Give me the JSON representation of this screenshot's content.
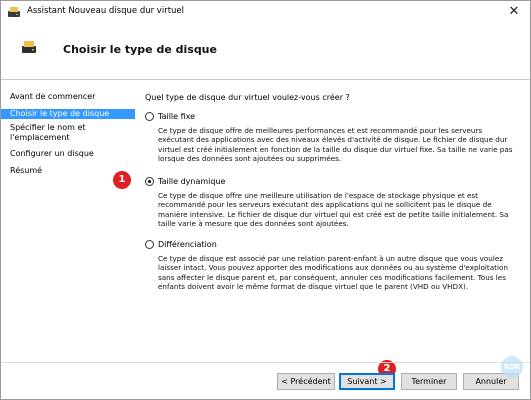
{
  "window": {
    "title": "Assistant Nouveau disque dur virtuel",
    "close_glyph": "✕"
  },
  "header": {
    "title": "Choisir le type de disque",
    "icon": "hard-disk-icon"
  },
  "nav": {
    "items": [
      {
        "label": "Avant de commencer",
        "active": false
      },
      {
        "label": "Choisir le type de disque",
        "active": true
      },
      {
        "label": "Spécifier le nom et l'emplacement",
        "active": false
      },
      {
        "label": "Configurer un disque",
        "active": false
      },
      {
        "label": "Résumé",
        "active": false
      }
    ]
  },
  "main": {
    "question": "Quel type de disque dur virtuel voulez-vous créer ?",
    "options": [
      {
        "label": "Taille fixe",
        "selected": false,
        "description": "Ce type de disque offre de meilleures performances et est recommandé pour les serveurs exécutant des applications avec des niveaux élevés d'activité de disque. Le fichier de disque dur virtuel est créé initialement en fonction de la taille du disque dur virtuel fixe. Sa taille ne varie pas lorsque des données sont ajoutées ou supprimées."
      },
      {
        "label": "Taille dynamique",
        "selected": true,
        "description": "Ce type de disque offre une meilleure utilisation de l'espace de stockage physique et est recommandé pour les serveurs exécutant des applications qui ne sollicitent pas le disque de manière intensive. Le fichier de disque dur virtuel qui est créé est de petite taille initialement. Sa taille varie à mesure que des données sont ajoutées."
      },
      {
        "label": "Différenciation",
        "selected": false,
        "description": "Ce type de disque est associé par une relation parent-enfant à un autre disque que vous voulez laisser intact. Vous pouvez apporter des modifications aux données ou au système d'exploitation sans affecter le disque parent et, par conséquent, annuler ces modifications facilement. Tous les enfants doivent avoir le même format de disque virtuel que le parent (VHD ou VHDX)."
      }
    ]
  },
  "annotations": {
    "step1": "1",
    "step2": "2"
  },
  "buttons": {
    "previous": "< Précédent",
    "next": "Suivant >",
    "finish": "Terminer",
    "cancel": "Annuler"
  },
  "watermark": {
    "text": "RDR"
  },
  "colors": {
    "selection": "#3399ff",
    "badge": "#e02020",
    "primary_border": "#0078d7"
  }
}
